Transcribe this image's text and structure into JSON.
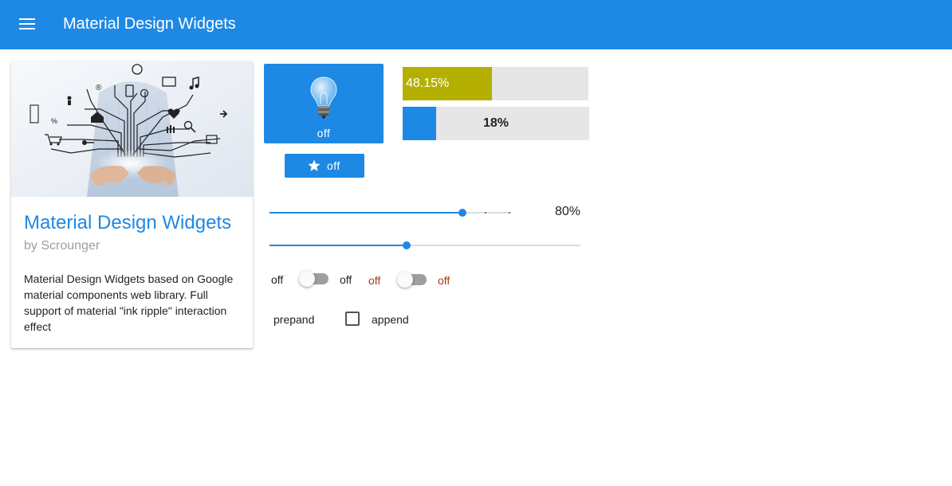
{
  "appbar": {
    "title": "Material Design Widgets",
    "color": "#1e88e5"
  },
  "card": {
    "title": "Material Design Widgets",
    "subtitle": "by Scrounger",
    "text": "Material Design Widgets based on Google material components web library. Full support of material \"ink ripple\" interaction effect"
  },
  "bulb_tile": {
    "label": "off",
    "icon": "lightbulb-icon"
  },
  "star_button": {
    "label": "off",
    "icon": "star-icon"
  },
  "progress1": {
    "label": "48.15%",
    "value": 0.4815,
    "color": "#b5b000"
  },
  "progress2": {
    "label": "18%",
    "value": 0.18,
    "color": "#1e88e5"
  },
  "slider1": {
    "value_label": "80%",
    "value": 0.8
  },
  "slider2": {
    "value": 0.44
  },
  "switches": {
    "s1_left": "off",
    "s1_right": "off",
    "s1_on": false,
    "s2_left": "off",
    "s2_right": "off",
    "s2_on": false
  },
  "checkbox": {
    "prepend_label": "prepand",
    "append_label": "append",
    "checked": false
  }
}
